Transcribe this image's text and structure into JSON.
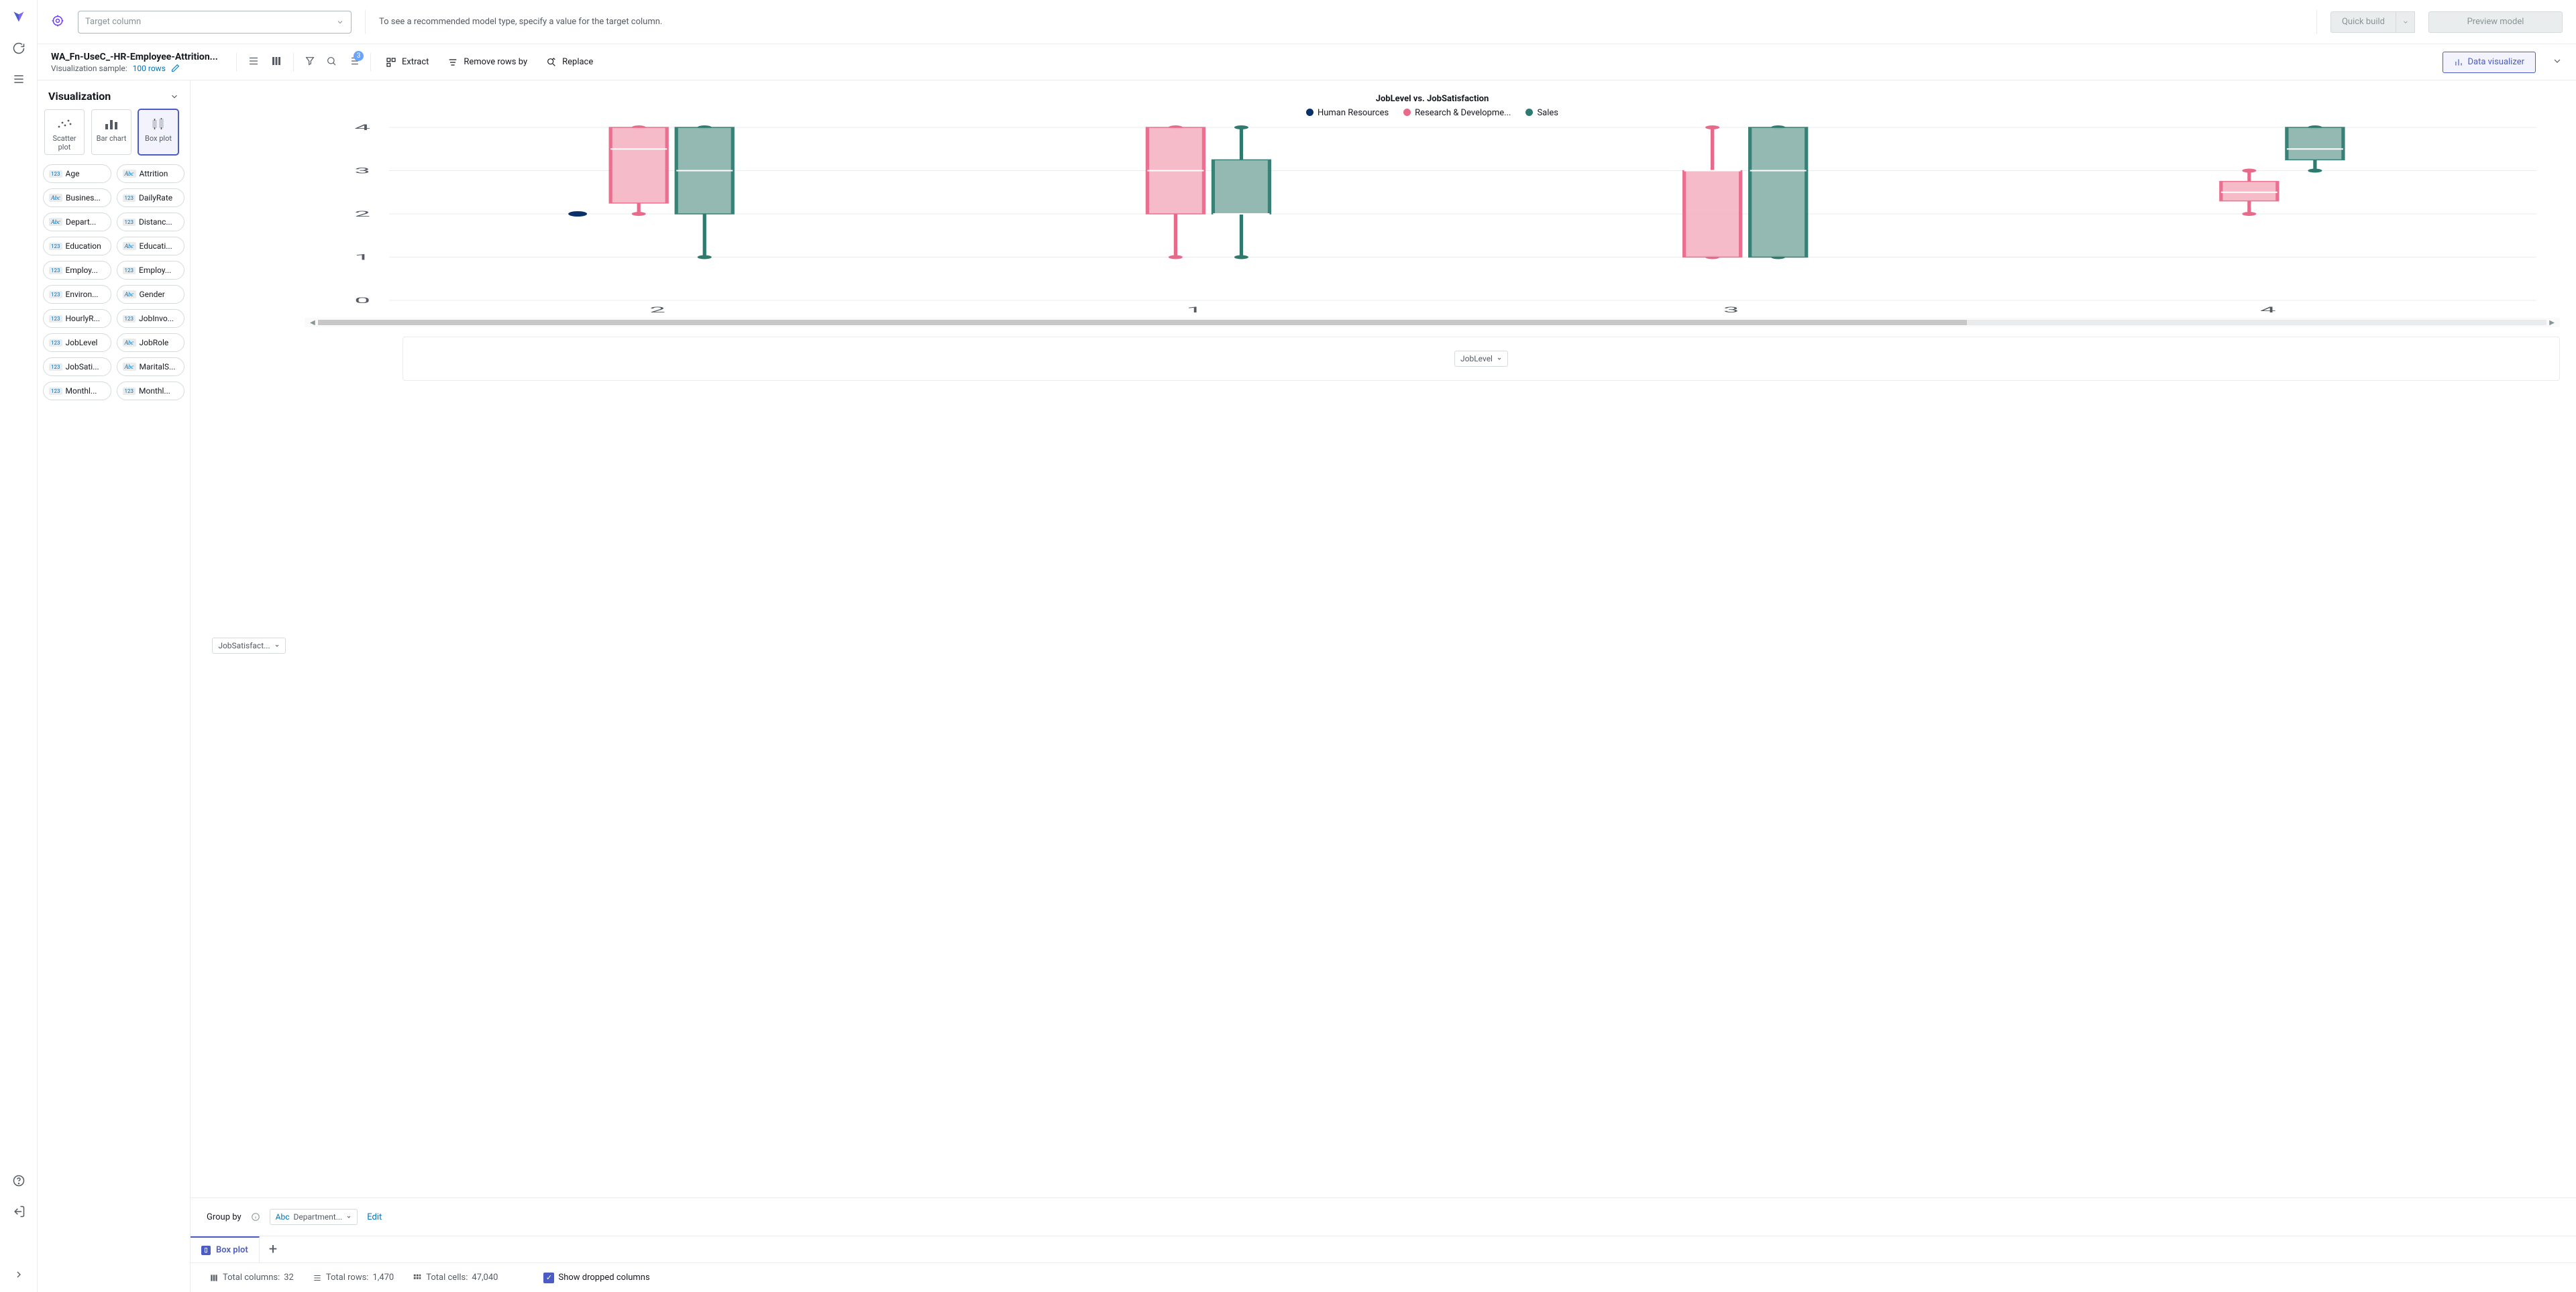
{
  "topbar": {
    "target_placeholder": "Target column",
    "hint": "To see a recommended model type, specify a value for the target column.",
    "quick_build": "Quick build",
    "preview_model": "Preview model"
  },
  "bar2": {
    "dataset_name": "WA_Fn-UseC_-HR-Employee-Attrition...",
    "sample_label": "Visualization sample:",
    "sample_value": "100 rows",
    "sort_badge": "3",
    "extract": "Extract",
    "remove_rows_by": "Remove rows by",
    "replace": "Replace",
    "data_visualizer": "Data visualizer"
  },
  "viz": {
    "title": "Visualization",
    "types": {
      "scatter": "Scatter plot",
      "bar": "Bar chart",
      "box": "Box plot"
    }
  },
  "columns": [
    {
      "t": "123",
      "n": "Age"
    },
    {
      "t": "Abc",
      "n": "Attrition"
    },
    {
      "t": "Abc",
      "n": "Busines..."
    },
    {
      "t": "123",
      "n": "DailyRate"
    },
    {
      "t": "Abc",
      "n": "Depart..."
    },
    {
      "t": "123",
      "n": "Distanc..."
    },
    {
      "t": "123",
      "n": "Education"
    },
    {
      "t": "Abc",
      "n": "Educati..."
    },
    {
      "t": "123",
      "n": "Employ..."
    },
    {
      "t": "123",
      "n": "Employ..."
    },
    {
      "t": "123",
      "n": "Environ..."
    },
    {
      "t": "Abc",
      "n": "Gender"
    },
    {
      "t": "123",
      "n": "HourlyR..."
    },
    {
      "t": "123",
      "n": "JobInvo..."
    },
    {
      "t": "123",
      "n": "JobLevel"
    },
    {
      "t": "Abc",
      "n": "JobRole"
    },
    {
      "t": "123",
      "n": "JobSati..."
    },
    {
      "t": "Abc",
      "n": "MaritalS..."
    },
    {
      "t": "123",
      "n": "Monthl..."
    },
    {
      "t": "123",
      "n": "Monthl..."
    }
  ],
  "chart": {
    "title": "JobLevel vs. JobSatisfaction",
    "y_field": "JobSatisfact...",
    "x_field": "JobLevel",
    "legend": {
      "hr": "Human Resources",
      "rd": "Research & Developme...",
      "sales": "Sales"
    },
    "colors": {
      "hr": "#0a3069",
      "rd": "#e86a8a",
      "sales": "#2f7a6f"
    },
    "fills": {
      "rd": "#f5b8c6",
      "sales": "#8fb5ae"
    }
  },
  "groupby": {
    "label": "Group by",
    "field": "Department...",
    "edit": "Edit"
  },
  "tab": "Box plot",
  "status": {
    "cols_label": "Total columns:",
    "cols": "32",
    "rows_label": "Total rows:",
    "rows": "1,470",
    "cells_label": "Total cells:",
    "cells": "47,040",
    "show_dropped": "Show dropped columns"
  },
  "chart_data": {
    "type": "box",
    "title": "JobLevel vs. JobSatisfaction",
    "xlabel": "JobLevel",
    "ylabel": "JobSatisfaction",
    "ylim": [
      0,
      4
    ],
    "yticks": [
      0,
      1,
      2,
      3,
      4
    ],
    "categories": [
      "2",
      "1",
      "3",
      "4"
    ],
    "series": [
      {
        "name": "Human Resources",
        "color": "#0a3069",
        "boxes": [
          {
            "cat": "2",
            "type": "point",
            "value": 2
          },
          {
            "cat": "1",
            "type": "none"
          },
          {
            "cat": "3",
            "type": "none"
          },
          {
            "cat": "4",
            "type": "none"
          }
        ]
      },
      {
        "name": "Research & Development",
        "color": "#e86a8a",
        "fill": "#f5b8c6",
        "boxes": [
          {
            "cat": "2",
            "min": 2,
            "q1": 2.25,
            "median": 3.5,
            "q3": 4,
            "max": 4
          },
          {
            "cat": "1",
            "min": 1,
            "q1": 2,
            "median": 3,
            "q3": 4,
            "max": 4
          },
          {
            "cat": "3",
            "min": 1,
            "q1": 1,
            "median": 3,
            "q3": 3,
            "max": 4
          },
          {
            "cat": "4",
            "min": 2,
            "q1": 2.3,
            "median": 2.5,
            "q3": 2.75,
            "max": 3
          }
        ]
      },
      {
        "name": "Sales",
        "color": "#2f7a6f",
        "fill": "#8fb5ae",
        "boxes": [
          {
            "cat": "2",
            "min": 1,
            "q1": 2,
            "median": 3,
            "q3": 4,
            "max": 4
          },
          {
            "cat": "1",
            "min": 1,
            "q1": 2,
            "median": 2,
            "q3": 3.25,
            "max": 4
          },
          {
            "cat": "3",
            "min": 1,
            "q1": 1,
            "median": 3,
            "q3": 4,
            "max": 4
          },
          {
            "cat": "4",
            "min": 3,
            "q1": 3.25,
            "median": 3.5,
            "q3": 4,
            "max": 4
          }
        ]
      }
    ]
  }
}
